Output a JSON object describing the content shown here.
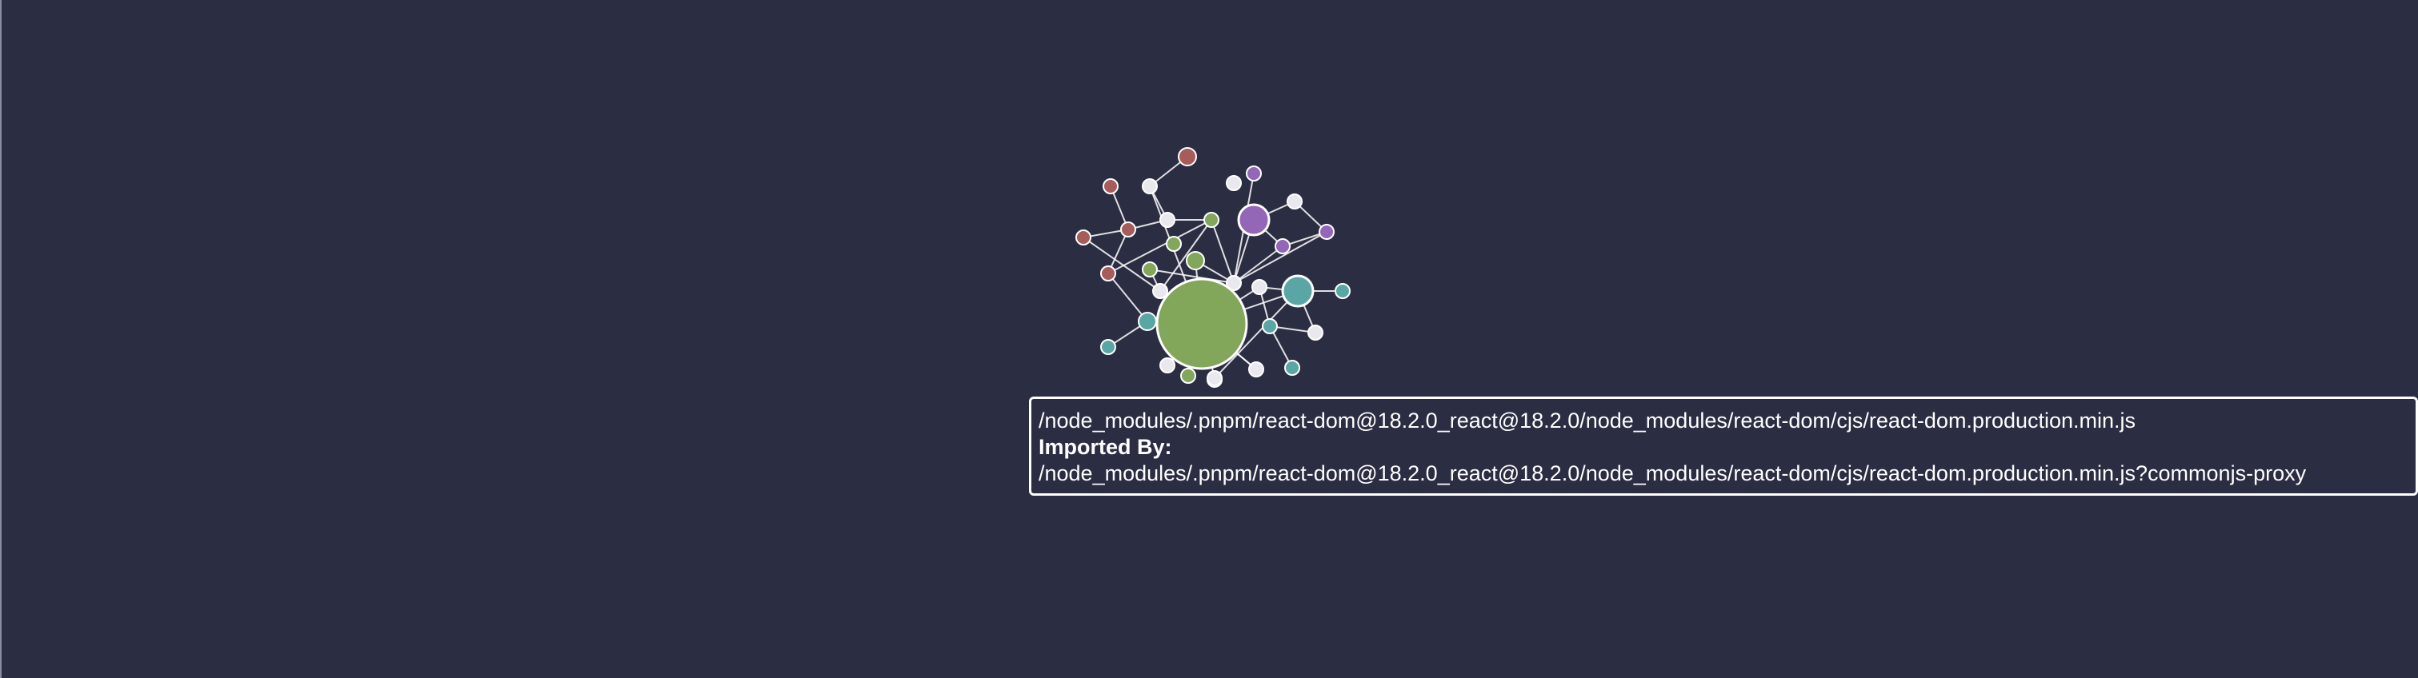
{
  "colors": {
    "background": "#2b2d42",
    "link": "#ffffff",
    "node_stroke": "#ffffff",
    "node_colors": {
      "green": "#82a65a",
      "teal": "#5aa6a4",
      "purple": "#9466b8",
      "red": "#a65c5a",
      "white": "#e8e8ee"
    }
  },
  "graph": {
    "nodes": [
      {
        "id": "n1",
        "color": "green",
        "size": 5
      },
      {
        "id": "n2",
        "color": "teal",
        "size": 3
      },
      {
        "id": "n3",
        "color": "purple",
        "size": 3
      },
      {
        "id": "n4",
        "color": "teal",
        "size": 2
      },
      {
        "id": "n5",
        "color": "green",
        "size": 2
      },
      {
        "id": "n6",
        "color": "red",
        "size": 2
      },
      {
        "id": "n7",
        "color": "white",
        "size": 1
      },
      {
        "id": "n8",
        "color": "white",
        "size": 1
      },
      {
        "id": "n9",
        "color": "red",
        "size": 1
      },
      {
        "id": "n10",
        "color": "red",
        "size": 1
      },
      {
        "id": "n11",
        "color": "red",
        "size": 1
      },
      {
        "id": "n12",
        "color": "red",
        "size": 1
      },
      {
        "id": "n13",
        "color": "white",
        "size": 1
      },
      {
        "id": "n14",
        "color": "green",
        "size": 1
      },
      {
        "id": "n15",
        "color": "green",
        "size": 1
      },
      {
        "id": "n16",
        "color": "green",
        "size": 1
      },
      {
        "id": "n17",
        "color": "white",
        "size": 1
      },
      {
        "id": "n18",
        "color": "purple",
        "size": 1
      },
      {
        "id": "n19",
        "color": "white",
        "size": 1
      },
      {
        "id": "n20",
        "color": "purple",
        "size": 1
      },
      {
        "id": "n21",
        "color": "purple",
        "size": 1
      },
      {
        "id": "n22",
        "color": "white",
        "size": 1
      },
      {
        "id": "n23",
        "color": "white",
        "size": 1
      },
      {
        "id": "n24",
        "color": "teal",
        "size": 1
      },
      {
        "id": "n25",
        "color": "teal",
        "size": 1
      },
      {
        "id": "n26",
        "color": "white",
        "size": 1
      },
      {
        "id": "n27",
        "color": "teal",
        "size": 1
      },
      {
        "id": "n28",
        "color": "white",
        "size": 1
      },
      {
        "id": "n29",
        "color": "teal",
        "size": 1
      },
      {
        "id": "n30",
        "color": "white",
        "size": 1
      },
      {
        "id": "n31",
        "color": "green",
        "size": 1
      },
      {
        "id": "n32",
        "color": "white",
        "size": 1
      },
      {
        "id": "n33",
        "color": "teal",
        "size": 1
      }
    ],
    "links": [
      [
        "n1",
        "n22"
      ],
      [
        "n1",
        "n23"
      ],
      [
        "n1",
        "n4"
      ],
      [
        "n1",
        "n30"
      ],
      [
        "n1",
        "n31"
      ],
      [
        "n1",
        "n2"
      ],
      [
        "n1",
        "n32"
      ],
      [
        "n1",
        "n26"
      ],
      [
        "n1",
        "n13"
      ],
      [
        "n1",
        "n5"
      ],
      [
        "n1",
        "n7"
      ],
      [
        "n22",
        "n18"
      ],
      [
        "n22",
        "n20"
      ],
      [
        "n22",
        "n21"
      ],
      [
        "n22",
        "n15"
      ],
      [
        "n22",
        "n5"
      ],
      [
        "n22",
        "n3"
      ],
      [
        "n22",
        "n16"
      ],
      [
        "n3",
        "n19"
      ],
      [
        "n3",
        "n20"
      ],
      [
        "n20",
        "n21"
      ],
      [
        "n19",
        "n21"
      ],
      [
        "n23",
        "n2"
      ],
      [
        "n23",
        "n24"
      ],
      [
        "n24",
        "n25"
      ],
      [
        "n24",
        "n28"
      ],
      [
        "n2",
        "n27"
      ],
      [
        "n2",
        "n28"
      ],
      [
        "n13",
        "n16"
      ],
      [
        "n13",
        "n15"
      ],
      [
        "n13",
        "n9"
      ],
      [
        "n16",
        "n8"
      ],
      [
        "n16",
        "n12"
      ],
      [
        "n7",
        "n8"
      ],
      [
        "n7",
        "n6"
      ],
      [
        "n8",
        "n10"
      ],
      [
        "n10",
        "n11"
      ],
      [
        "n12",
        "n10"
      ],
      [
        "n10",
        "n9"
      ],
      [
        "n4",
        "n12"
      ],
      [
        "n4",
        "n33"
      ],
      [
        "n4",
        "n1"
      ],
      [
        "n26",
        "n1"
      ],
      [
        "n30",
        "n2"
      ]
    ]
  },
  "tooltip": {
    "module_path": "/node_modules/.pnpm/react-dom@18.2.0_react@18.2.0/node_modules/react-dom/cjs/react-dom.production.min.js",
    "imported_by_label": "Imported By:",
    "importer_path": "/node_modules/.pnpm/react-dom@18.2.0_react@18.2.0/node_modules/react-dom/cjs/react-dom.production.min.js?commonjs-proxy"
  }
}
